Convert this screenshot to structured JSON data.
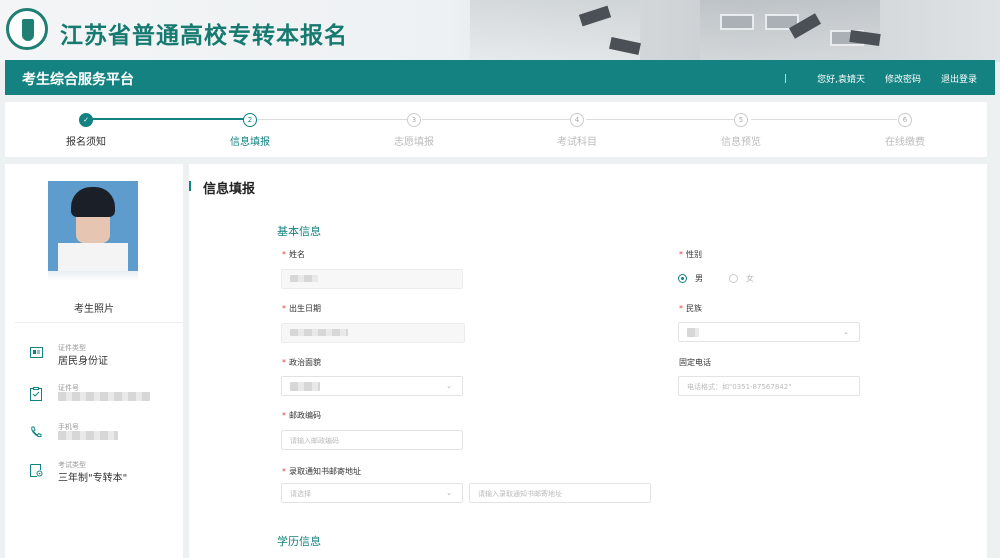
{
  "header": {
    "site_title": "江苏省普通高校专转本报名",
    "platform_title": "考生综合服务平台",
    "separator": "|",
    "greeting": "您好,袁婧天",
    "change_password": "修改密码",
    "logout": "退出登录",
    "accent_color": "#138281"
  },
  "steps": [
    {
      "number": "✓",
      "label": "报名须知",
      "state": "done"
    },
    {
      "number": "2",
      "label": "信息填报",
      "state": "active"
    },
    {
      "number": "3",
      "label": "志愿填报",
      "state": "pending"
    },
    {
      "number": "4",
      "label": "考试科目",
      "state": "pending"
    },
    {
      "number": "5",
      "label": "信息预览",
      "state": "pending"
    },
    {
      "number": "6",
      "label": "在线缴费",
      "state": "pending"
    }
  ],
  "sidebar": {
    "photo_caption": "考生照片",
    "items": [
      {
        "icon": "id-card-icon",
        "small": "证件类型",
        "value": "居民身份证"
      },
      {
        "icon": "clipboard-icon",
        "small": "证件号",
        "value": ""
      },
      {
        "icon": "phone-icon",
        "small": "手机号",
        "value": ""
      },
      {
        "icon": "exam-type-icon",
        "small": "考试类型",
        "value": "三年制\"专转本\""
      }
    ]
  },
  "main": {
    "title": "信息填报",
    "section_basic": "基本信息",
    "section_education": "学历信息",
    "fields": {
      "name_label": "姓名",
      "gender_label": "性别",
      "gender_male": "男",
      "gender_female": "女",
      "birth_label": "出生日期",
      "ethnicity_label": "民族",
      "political_label": "政治面貌",
      "phone_label": "固定电话",
      "phone_placeholder": "电话格式：如\"0351-87567842\"",
      "postal_label": "邮政编码",
      "postal_placeholder": "请输入邮政编码",
      "address_label": "录取通知书邮寄地址",
      "address_select_placeholder": "请选择",
      "address_detail_placeholder": "请输入录取通知书邮寄地址"
    }
  }
}
